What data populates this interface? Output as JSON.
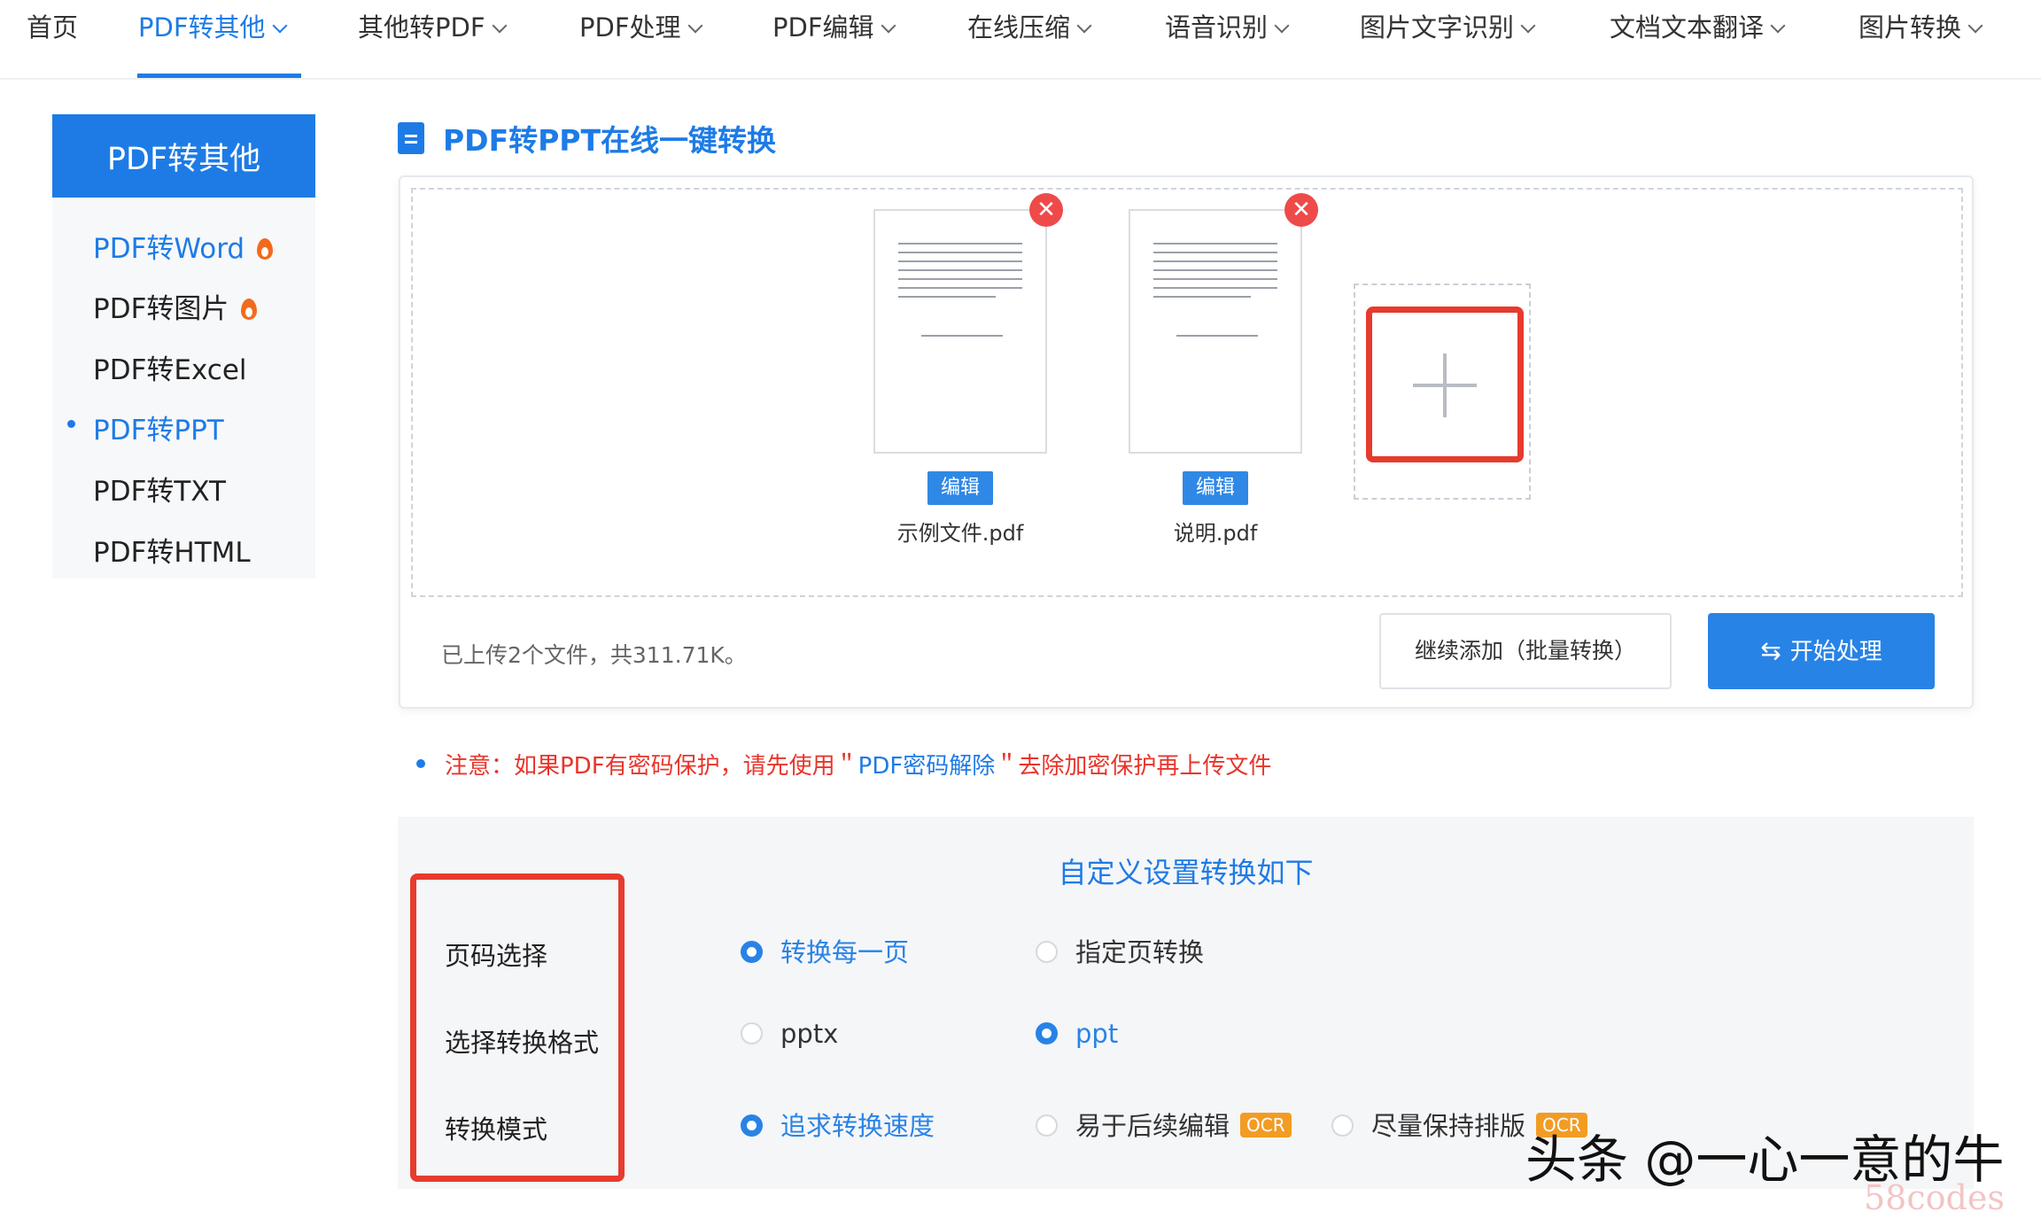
{
  "nav": {
    "items": [
      {
        "label": "首页"
      },
      {
        "label": "PDF转其他"
      },
      {
        "label": "其他转PDF"
      },
      {
        "label": "PDF处理"
      },
      {
        "label": "PDF编辑"
      },
      {
        "label": "在线压缩"
      },
      {
        "label": "语音识别"
      },
      {
        "label": "图片文字识别"
      },
      {
        "label": "文档文本翻译"
      },
      {
        "label": "图片转换"
      }
    ],
    "active_index": 1
  },
  "sidebar": {
    "title": "PDF转其他",
    "items": [
      {
        "label": "PDF转Word",
        "hot": true
      },
      {
        "label": "PDF转图片",
        "hot": true
      },
      {
        "label": "PDF转Excel"
      },
      {
        "label": "PDF转PPT",
        "active": true
      },
      {
        "label": "PDF转TXT"
      },
      {
        "label": "PDF转HTML"
      }
    ]
  },
  "main": {
    "title": "PDF转PPT在线一键转换",
    "files": [
      {
        "name": "示例文件.pdf",
        "edit_label": "编辑"
      },
      {
        "name": "说明.pdf",
        "edit_label": "编辑"
      }
    ],
    "remove_glyph": "✕",
    "upload_info": "已上传2个文件，共311.71K。",
    "add_more_label": "继续添加（批量转换）",
    "start_label": "开始处理",
    "notice_prefix": "注意：如果PDF有密码保护，请先使用＂",
    "notice_link": "PDF密码解除",
    "notice_suffix": "＂去除加密保护再上传文件"
  },
  "settings": {
    "title": "自定义设置转换如下",
    "rows": [
      {
        "label": "页码选择",
        "options": [
          {
            "label": "转换每一页",
            "selected": true
          },
          {
            "label": "指定页转换"
          }
        ]
      },
      {
        "label": "选择转换格式",
        "options": [
          {
            "label": "pptx"
          },
          {
            "label": "ppt",
            "selected": true
          }
        ]
      },
      {
        "label": "转换模式",
        "options": [
          {
            "label": "追求转换速度",
            "selected": true
          },
          {
            "label": "易于后续编辑",
            "badge": "OCR"
          },
          {
            "label": "尽量保持排版",
            "badge": "OCR"
          }
        ]
      }
    ]
  },
  "watermark": {
    "text": "头条 @一心一意的牛",
    "sub": "58codes"
  },
  "colors": {
    "accent": "#1e7be6",
    "highlight": "#e63b2e",
    "warning": "#e8352b",
    "badge": "#f39c24"
  }
}
